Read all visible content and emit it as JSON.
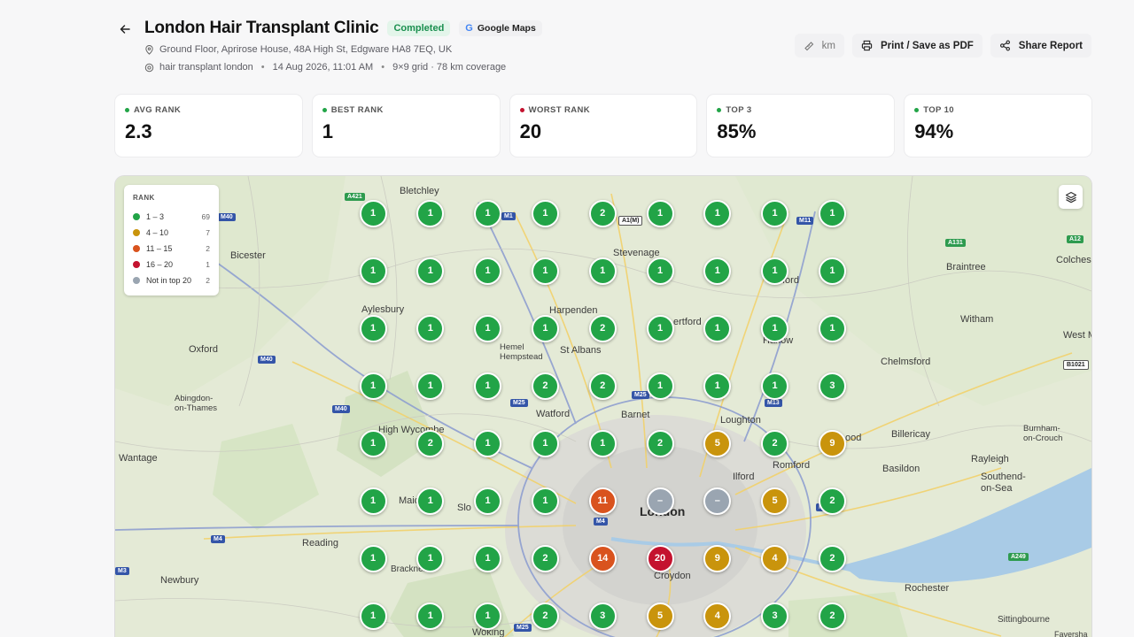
{
  "header": {
    "title": "London Hair Transplant Clinic",
    "status": "Completed",
    "source": "Google Maps",
    "address": "Ground Floor, Aprirose House, 48A High St, Edgware HA8 7EQ, UK",
    "keyword": "hair transplant london",
    "date": "14 Aug 2026, 11:01 AM",
    "grid_info": "9×9 grid · 78 km coverage"
  },
  "actions": {
    "unit": "km",
    "print": "Print / Save as PDF",
    "share": "Share Report"
  },
  "stats": [
    {
      "label": "AVG RANK",
      "value": "2.3",
      "color": "#22a447"
    },
    {
      "label": "BEST RANK",
      "value": "1",
      "color": "#22a447"
    },
    {
      "label": "WORST RANK",
      "value": "20",
      "color": "#c4122f"
    },
    {
      "label": "TOP 3",
      "value": "85%",
      "color": "#22a447"
    },
    {
      "label": "TOP 10",
      "value": "94%",
      "color": "#22a447"
    }
  ],
  "legend": {
    "title": "RANK",
    "items": [
      {
        "label": "1 – 3",
        "count": "69",
        "color": "#22a447"
      },
      {
        "label": "4 – 10",
        "count": "7",
        "color": "#c9940c"
      },
      {
        "label": "11 – 15",
        "count": "2",
        "color": "#d9531e"
      },
      {
        "label": "16 – 20",
        "count": "1",
        "color": "#c4122f"
      },
      {
        "label": "Not in top 20",
        "count": "2",
        "color": "#9aa5b1"
      }
    ]
  },
  "map": {
    "places": {
      "bletchley": "Bletchley",
      "bicester": "Bicester",
      "stevenage": "Stevenage",
      "braintree": "Braintree",
      "colchester": "Colches",
      "aylesbury": "Aylesbury",
      "harpenden": "Harpenden",
      "hertford": "ertford",
      "harlow": "Harlow",
      "witham": "Witham",
      "west_mersea": "West M",
      "oxford": "Oxford",
      "hemel": "Hemel\nHempstead",
      "st_albans": "St Albans",
      "chelmsford": "Chelmsford",
      "abingdon": "Abingdon-\non-Thames",
      "watford": "Watford",
      "barnet": "Barnet",
      "loughton": "Loughton",
      "high_wycombe": "High Wycombe",
      "billericay": "Billericay",
      "burnham": "Burnham-\non-Crouch",
      "wantage": "Wantage",
      "romford": "Romford",
      "basildon": "Basildon",
      "rayleigh": "Rayleigh",
      "ilford": "Ilford",
      "southend": "Southend-\non-Sea",
      "maidenhead": "Maid",
      "slough": "Slo",
      "london": "London",
      "reading": "Reading",
      "newbury": "Newbury",
      "bracknell": "Bracknell",
      "croydon": "Croydon",
      "rochester": "Rochester",
      "woking": "Woking",
      "sittingbourne": "Sittingbourne",
      "faversham": "Faversha",
      "ford": "ford",
      "ood": "ood"
    },
    "roads": {
      "a421": "A421",
      "m1": "M1",
      "a1m": "A1(M)",
      "m11": "M11",
      "a131": "A131",
      "a12": "A12",
      "m40a": "M40",
      "m40b": "M40",
      "m40c": "M40",
      "m25a": "M25",
      "m25b": "M25",
      "b1021": "B1021",
      "m4a": "M4",
      "m4b": "M4",
      "a249": "A249",
      "m25c": "M25",
      "m13": "M13",
      "m2": "M2",
      "m3": "M3"
    },
    "grid": [
      [
        "1",
        "1",
        "1",
        "1",
        "2",
        "1",
        "1",
        "1",
        "1"
      ],
      [
        "1",
        "1",
        "1",
        "1",
        "1",
        "1",
        "1",
        "1",
        "1"
      ],
      [
        "1",
        "1",
        "1",
        "1",
        "2",
        "1",
        "1",
        "1",
        "1"
      ],
      [
        "1",
        "1",
        "1",
        "2",
        "2",
        "1",
        "1",
        "1",
        "3"
      ],
      [
        "1",
        "2",
        "1",
        "1",
        "1",
        "2",
        "5",
        "2",
        "9"
      ],
      [
        "1",
        "1",
        "1",
        "1",
        "11",
        "–",
        "–",
        "5",
        "2"
      ],
      [
        "1",
        "1",
        "1",
        "2",
        "14",
        "20",
        "9",
        "4",
        "2"
      ],
      [
        "1",
        "1",
        "1",
        "2",
        "3",
        "5",
        "4",
        "3",
        "2"
      ]
    ]
  }
}
